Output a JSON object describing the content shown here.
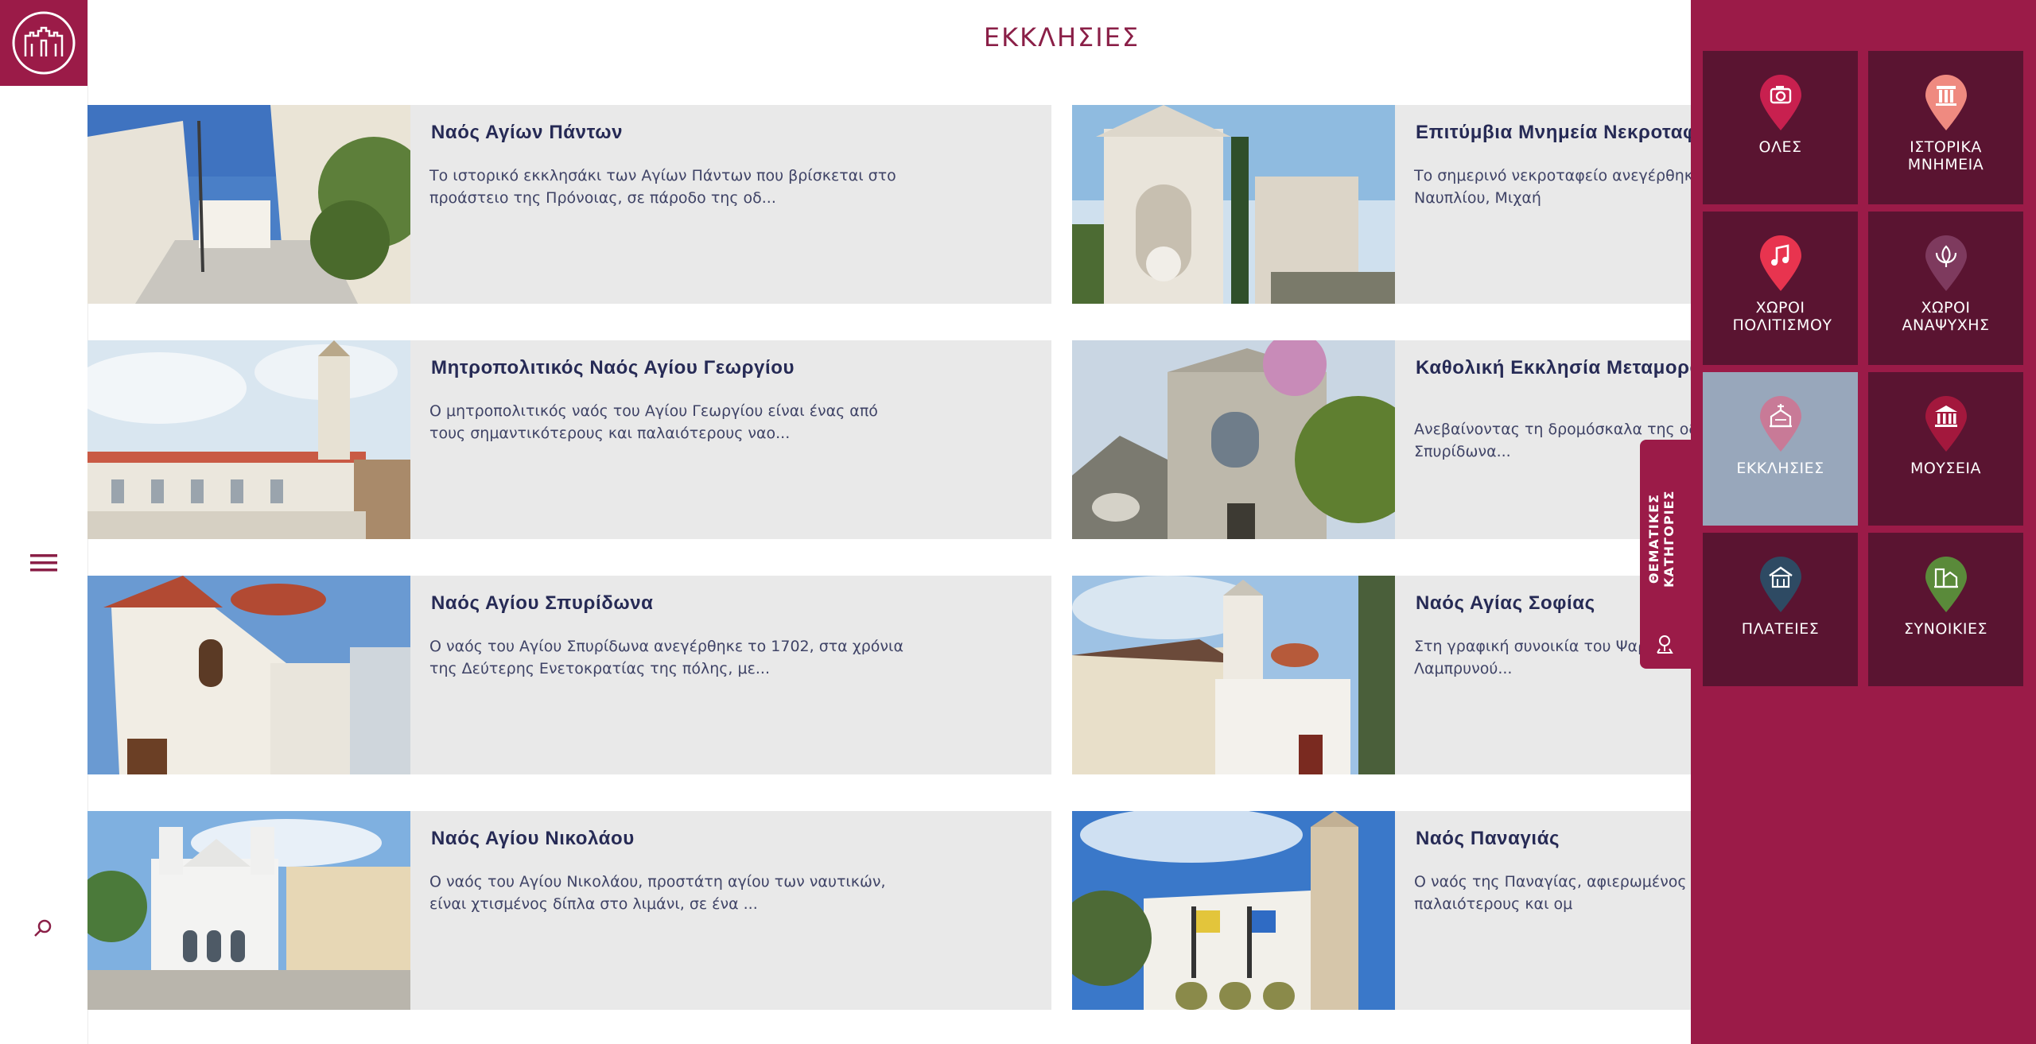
{
  "header": {
    "title": "ΕΚΚΛΗΣΙΕΣ"
  },
  "cards": [
    {
      "title": "Ναός Αγίων Πάντων",
      "desc": "Το ιστορικό εκκλησάκι των Αγίων Πάντων που βρίσκεται στο προάστειο της Πρόνοιας, σε πάροδο της οδ..."
    },
    {
      "title": "Επιτύμβια Μνημεία Νεκροταφ",
      "desc": "Το σημερινό νεκροταφείο ανεγέρθηκ μεγάλο δωρητή του Ναυπλίου, Μιχαή"
    },
    {
      "title": "Μητροπολιτικός Ναός Αγίου Γεωργίου",
      "desc": "Ο μητροπολιτικός ναός του Αγίου Γεωργίου είναι ένας από τους σημαντικότερους και παλαιότερους ναο..."
    },
    {
      "title": "Καθολική Εκκλησία Μεταμορφ Σωτήρος",
      "desc": "Ανεβαίνοντας τη δρομόσκαλα της οδ πλατεία του Αγίου Σπυρίδωνα..."
    },
    {
      "title": "Ναός Αγίου Σπυρίδωνα",
      "desc": "Ο ναός του Αγίου Σπυρίδωνα ανεγέρθηκε το 1702, στα χρόνια της Δεύτερης Ενετοκρατίας της πόλης, με..."
    },
    {
      "title": "Ναός Αγίας Σοφίας",
      "desc": "Στη γραφική συνοικία του Ψαρ δρομόσκαλα της οδού Λαμπρυνού..."
    },
    {
      "title": "Ναός Αγίου Νικολάου",
      "desc": "Ο ναός του Αγίου Νικολάου, προστάτη αγίου των ναυτικών, είναι χτισμένος δίπλα στο λιμάνι, σε ένα ..."
    },
    {
      "title": "Ναός Παναγιάς",
      "desc": "Ο ναός της Παναγίας, αφιερωμένος σ είναι από τους παλαιότερους και ομ"
    }
  ],
  "categories": {
    "tab_label": "ΘΕΜΑΤΙΚΕΣ ΚΑΤΗΓΟΡΙΕΣ",
    "items": [
      {
        "label": "ΟΛΕΣ",
        "icon": "camera-icon",
        "color": "#c8204f"
      },
      {
        "label": "ΙΣΤΟΡΙΚΑ ΜΝΗΜΕΙΑ",
        "icon": "column-icon",
        "color": "#ef8a80"
      },
      {
        "label": "ΧΩΡΟΙ ΠΟΛΙΤΙΣΜΟΥ",
        "icon": "music-note-icon",
        "color": "#e8344f"
      },
      {
        "label": "ΧΩΡΟΙ ΑΝΑΨΥΧΗΣ",
        "icon": "lotus-icon",
        "color": "#7e3a5e"
      },
      {
        "label": "ΕΚΚΛΗΣΙΕΣ",
        "icon": "church-icon",
        "color": "#c87a97"
      },
      {
        "label": "ΜΟΥΣΕΙΑ",
        "icon": "museum-icon",
        "color": "#a3183d"
      },
      {
        "label": "ΠΛΑΤΕΙΕΣ",
        "icon": "square-icon",
        "color": "#2e4a63"
      },
      {
        "label": "ΣΥΝΟΙΚΙΕΣ",
        "icon": "houses-icon",
        "color": "#5a8a3a"
      }
    ]
  },
  "colors": {
    "brand": "#9b1b48",
    "tile": "#5a1431",
    "active_tile": "#98a7bb",
    "card_bg": "#e9e9e9",
    "title": "#262a55"
  }
}
